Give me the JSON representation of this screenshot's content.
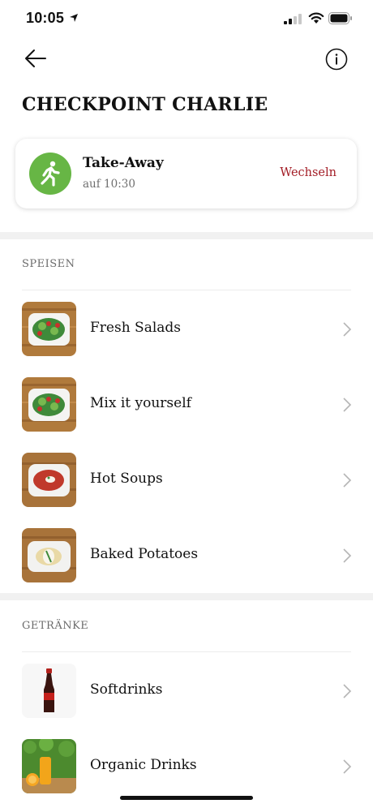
{
  "status_bar": {
    "time": "10:05"
  },
  "header": {
    "title": "CHECKPOINT CHARLIE"
  },
  "order": {
    "type_label": "Take-Away",
    "time_label": "auf 10:30",
    "change_label": "Wechseln"
  },
  "sections": [
    {
      "title": "SPEISEN",
      "items": [
        {
          "label": "Fresh Salads",
          "image": "salad-image"
        },
        {
          "label": "Mix it yourself",
          "image": "salad-image"
        },
        {
          "label": "Hot Soups",
          "image": "soup-image"
        },
        {
          "label": "Baked Potatoes",
          "image": "potato-image"
        }
      ]
    },
    {
      "title": "GETRÄNKE",
      "items": [
        {
          "label": "Softdrinks",
          "image": "cola-bottle-image"
        },
        {
          "label": "Organic Drinks",
          "image": "juice-image"
        }
      ]
    }
  ],
  "colors": {
    "accent": "#a31d26",
    "takeaway_green": "#67b645",
    "divider": "#f1f1f1"
  }
}
